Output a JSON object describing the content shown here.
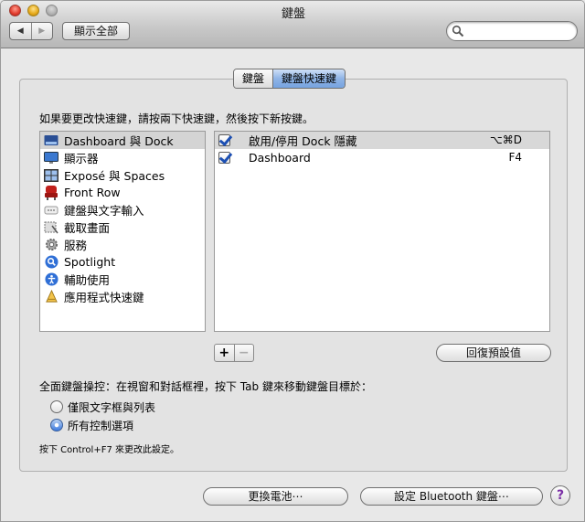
{
  "window": {
    "title": "鍵盤"
  },
  "toolbar": {
    "back_glyph": "◀",
    "forward_glyph": "▶",
    "show_all": "顯示全部",
    "search_value": ""
  },
  "tabs": [
    {
      "label": "鍵盤",
      "active": false
    },
    {
      "label": "鍵盤快速鍵",
      "active": true
    }
  ],
  "instructions": "如果要更改快速鍵，請按兩下快速鍵，然後按下新按鍵。",
  "categories": [
    {
      "label": "Dashboard 與 Dock",
      "icon": "dashboard-dock-icon",
      "selected": true
    },
    {
      "label": "顯示器",
      "icon": "display-icon"
    },
    {
      "label": "Exposé 與 Spaces",
      "icon": "expose-spaces-icon"
    },
    {
      "label": "Front Row",
      "icon": "front-row-icon"
    },
    {
      "label": "鍵盤與文字輸入",
      "icon": "keyboard-text-input-icon"
    },
    {
      "label": "截取畫面",
      "icon": "screenshot-icon"
    },
    {
      "label": "服務",
      "icon": "services-gear-icon"
    },
    {
      "label": "Spotlight",
      "icon": "spotlight-icon"
    },
    {
      "label": "輔助使用",
      "icon": "universal-access-icon"
    },
    {
      "label": "應用程式快速鍵",
      "icon": "app-shortcuts-icon"
    }
  ],
  "shortcuts": [
    {
      "label": "啟用/停用 Dock 隱藏",
      "key": "⌥⌘D",
      "checked": true,
      "selected": true
    },
    {
      "label": "Dashboard",
      "key": "F4",
      "checked": true,
      "selected": false
    }
  ],
  "buttons": {
    "add": "+",
    "remove": "−",
    "restore_defaults": "回復預設值",
    "change_battery": "更換電池⋯",
    "setup_bluetooth": "設定 Bluetooth 鍵盤⋯",
    "help": "?"
  },
  "full_keyboard_access": {
    "label": "全面鍵盤操控：在視窗和對話框裡，按下 Tab 鍵來移動鍵盤目標於：",
    "options": [
      {
        "label": "僅限文字框與列表",
        "selected": false
      },
      {
        "label": "所有控制選項",
        "selected": true
      }
    ],
    "note": "按下 Control+F7 來更改此設定。"
  }
}
